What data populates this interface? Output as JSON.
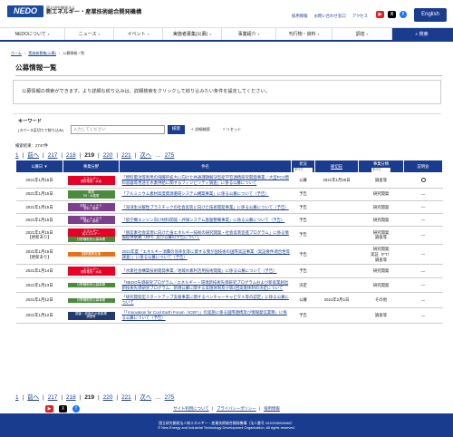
{
  "header": {
    "logo_mark": "NEDO",
    "org_sub": "国立研究開発法人",
    "org_name": "新エネルギー・産業技術総合開発機構",
    "links": [
      "採用情報",
      "お問い合わせ窓口",
      "アクセス"
    ],
    "english": "English",
    "sns": [
      "youtube-icon",
      "x-icon",
      "facebook-icon"
    ]
  },
  "nav": {
    "items": [
      "NEDOについて",
      "ニュース",
      "イベント",
      "実施者募集(公募)",
      "事業紹介",
      "刊行物・資料",
      "調達"
    ],
    "search": "検索"
  },
  "breadcrumb": [
    "ホーム",
    "実施者募集(公募)",
    "公募情報一覧"
  ],
  "page_title": "公募情報一覧",
  "description": "公募情報の検索ができます。より詳細な絞り込みは、詳細検索をクリックして絞り込みたい条件を設定してください。",
  "search": {
    "label": "キーワード",
    "sub_label": "(スペース区切りで絞り込み)",
    "placeholder": "入力してください",
    "button": "検索",
    "detail": "＋ 詳細検索",
    "reset": "× リセット"
  },
  "result_count": "検索結果：2747件",
  "pager": {
    "first": "1",
    "prev": "前へ",
    "pages": [
      "217",
      "218",
      "219",
      "220",
      "221"
    ],
    "current": "219",
    "next": "次へ",
    "last": "275"
  },
  "table": {
    "headers": {
      "date": "公募日",
      "field": "事業分野",
      "subject": "件名",
      "status": "状況",
      "status_select": "すべて",
      "deadline": "締切日",
      "type": "事業分類",
      "type_select": "すべて",
      "briefing": "説明会"
    },
    "rows": [
      {
        "date": "2021年1月15日",
        "date2": "",
        "tags": [
          {
            "t": "エネルギー",
            "s": "燃料電池・水素",
            "c": "red"
          }
        ],
        "subject": "「燃料電池等利用の飛躍的拡大に向けた共通課題解決型産学官連携研究開発事業／大型FCV燃料容器等用途を水素供給に関するフィジビリティ調査」に係る公募について",
        "status": "公募",
        "deadline": "2021年1月29日",
        "type": "調査等",
        "briefing": "○"
      },
      {
        "date": "2021年1月15日",
        "date2": "",
        "tags": [
          {
            "t": "環境",
            "s": "3R・水循環",
            "c": "green"
          }
        ],
        "subject": "「アルミニウム素材高度資源循環システム構築事業」に係る公募について（予告）",
        "status": "予告",
        "deadline": "",
        "type": "研究開発",
        "briefing": "—"
      },
      {
        "date": "2021年1月15日",
        "date2": "",
        "tags": [
          {
            "t": "材料・ナノテク",
            "s": "材料・部材",
            "c": "purple"
          }
        ],
        "subject": "「海洋生分解性プラスチックの社会実装に向けた技術開発事業」に係る公募について（予告）",
        "status": "予告",
        "deadline": "",
        "type": "研究開発",
        "briefing": "—"
      },
      {
        "date": "2021年1月15日",
        "date2": "",
        "tags": [
          {
            "t": "材料・ナノテク",
            "s": "材料・部材",
            "c": "purple"
          }
        ],
        "subject": "「航空機エンジン向け材料開発・評価システム基盤整備事業」に係る公募について（予告）",
        "status": "予告",
        "deadline": "",
        "type": "研究開発",
        "briefing": "—"
      },
      {
        "date": "2021年1月15日",
        "date2": "【更新あり】",
        "tags": [
          {
            "t": "エネルギー",
            "s": "省エネルギー",
            "c": "red"
          },
          {
            "t": "分野横断的公募事業",
            "s": "",
            "c": "green"
          }
        ],
        "subject": "「脱炭素社会実現に向けた省エネルギー技術の研究開発・社会実装促進プログラム」に係る情報提供依頼（RFI）及び公募の予告について",
        "status": "予告",
        "deadline": "",
        "type": "研究開発\n調査等",
        "briefing": "—"
      },
      {
        "date": "2021年1月15日",
        "date2": "【更新あり】",
        "tags": [
          {
            "t": "国際展開支援",
            "s": "",
            "c": "orange"
          }
        ],
        "subject": "2021年度「エネルギー消費の効率化等に資する我が国技術の国際実証事業（実証要件適合性等調査）」に係る公募について（予告）",
        "status": "予告",
        "deadline": "",
        "type": "研究開発\n実証（FT）\n調査等",
        "briefing": "—"
      },
      {
        "date": "2021年1月14日",
        "date2": "",
        "tags": [
          {
            "t": "エネルギー",
            "s": "燃料電池・水素",
            "c": "red"
          }
        ],
        "subject": "「水素社会構築技術開発事業／地域水素利活用技術開発」に係る公募について（予告）",
        "status": "予告",
        "deadline": "",
        "type": "研究開発",
        "briefing": "—"
      },
      {
        "date": "2021年1月13日",
        "date2": "",
        "tags": [
          {
            "t": "分野横断的公募事業",
            "s": "",
            "c": "green"
          }
        ],
        "subject": "「NEDO先導研究プログラム／エネルギー・環境新技術先導研究プログラムおよび新産業創出新技術先導研究プログラム、新規公募に関する実施体制及び第2回実施体制の決定について",
        "status": "決定",
        "deadline": "",
        "type": "研究開発",
        "briefing": "—"
      },
      {
        "date": "2021年1月12日",
        "date2": "",
        "tags": [
          {
            "t": "分野横断的公募事業",
            "s": "",
            "c": "green"
          }
        ],
        "subject": "「研究開発型スタートアップ支援事業に関するベンチャーキャピタル等の認定」に係る公募について",
        "status": "公募",
        "deadline": "2021年2月1日",
        "type": "その他",
        "briefing": "—"
      },
      {
        "date": "2021年1月12日",
        "date2": "",
        "tags": [
          {
            "t": "調査・評価その他事業",
            "s": "調査等",
            "c": "navy"
          }
        ],
        "subject": "「「Innovation for Cool Earth Forum（ICEF）」の実施に係る国際連携及び情報発信業務」に係る公募について（予告）",
        "status": "予告",
        "deadline": "",
        "type": "調査等",
        "briefing": "—"
      }
    ]
  },
  "footer": {
    "links": [
      "サイト利用について",
      "プライバシーポリシー",
      "採用情報"
    ],
    "org": "国立研究開発法人新エネルギー・産業技術総合開発機構（法人番号 2020005008480）",
    "copyright": "© New Energy and Industrial Technology Development Organization. All rights reserved."
  },
  "colors": {
    "brand": "#1a3c8f",
    "energy": "#e60026",
    "environment": "#4a8b3c",
    "materials": "#7b3f8c",
    "international": "#e6731a"
  }
}
